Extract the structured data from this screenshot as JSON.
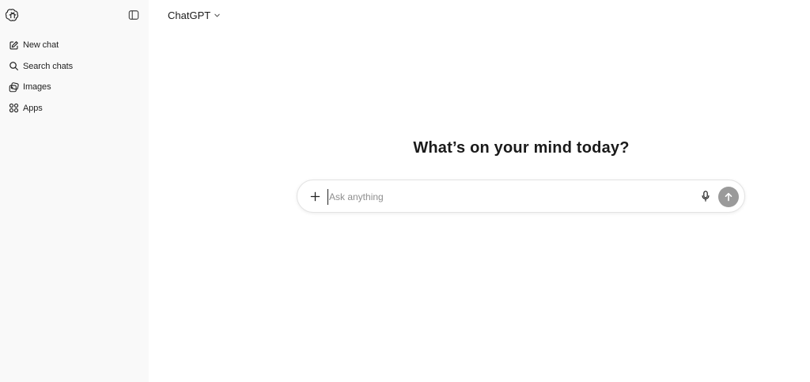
{
  "app": {
    "name": "ChatGPT"
  },
  "sidebar": {
    "logo_icon": "openai-logo-icon",
    "toggle_icon": "sidebar-toggle-icon",
    "items": [
      {
        "label": "New chat",
        "icon": "edit-icon"
      },
      {
        "label": "Search chats",
        "icon": "search-icon"
      },
      {
        "label": "Images",
        "icon": "images-icon"
      },
      {
        "label": "Apps",
        "icon": "apps-icon"
      }
    ]
  },
  "header": {
    "model_label": "ChatGPT",
    "chevron_icon": "chevron-down-icon"
  },
  "main": {
    "headline": "What’s on your mind today?"
  },
  "composer": {
    "placeholder": "Ask anything",
    "value": "",
    "plus_icon": "plus-icon",
    "mic_icon": "mic-icon",
    "send_icon": "arrow-up-icon"
  },
  "colors": {
    "sidebar_bg": "#f9f9f9",
    "send_button": "#9a9a9a",
    "text": "#1a1a1a"
  }
}
